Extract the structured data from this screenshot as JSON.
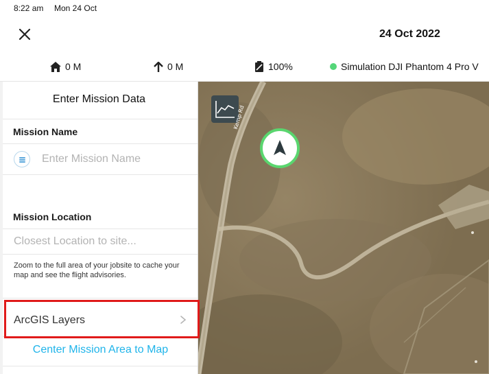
{
  "status_bar": {
    "time": "8:22 am",
    "date": "Mon 24 Oct"
  },
  "nav": {
    "title": "24 Oct 2022",
    "close_icon": "close-icon"
  },
  "telemetry": {
    "home_distance": "0 M",
    "altitude": "0 M",
    "battery": "100%",
    "aircraft": "Simulation DJI Phantom 4 Pro V",
    "connection_color": "#54d679"
  },
  "panel": {
    "title": "Enter Mission Data",
    "mission_name_label": "Mission Name",
    "mission_name_placeholder": "Enter Mission Name",
    "mission_location_label": "Mission Location",
    "location_placeholder": "Closest Location to site...",
    "hint": "Zoom to the full area of your jobsite to cache your map and see the flight advisories.",
    "arcgis_label": "ArcGIS Layers",
    "center_link": "Center Mission Area to Map",
    "accent_color": "#1fb4ea",
    "highlight_color": "#e01a1a"
  },
  "map": {
    "road_label": "Kemp Rd",
    "chart_icon": "line-chart-icon",
    "drone_icon": "navigation-arrow-icon",
    "drone_ring_color": "#5ad66f"
  }
}
